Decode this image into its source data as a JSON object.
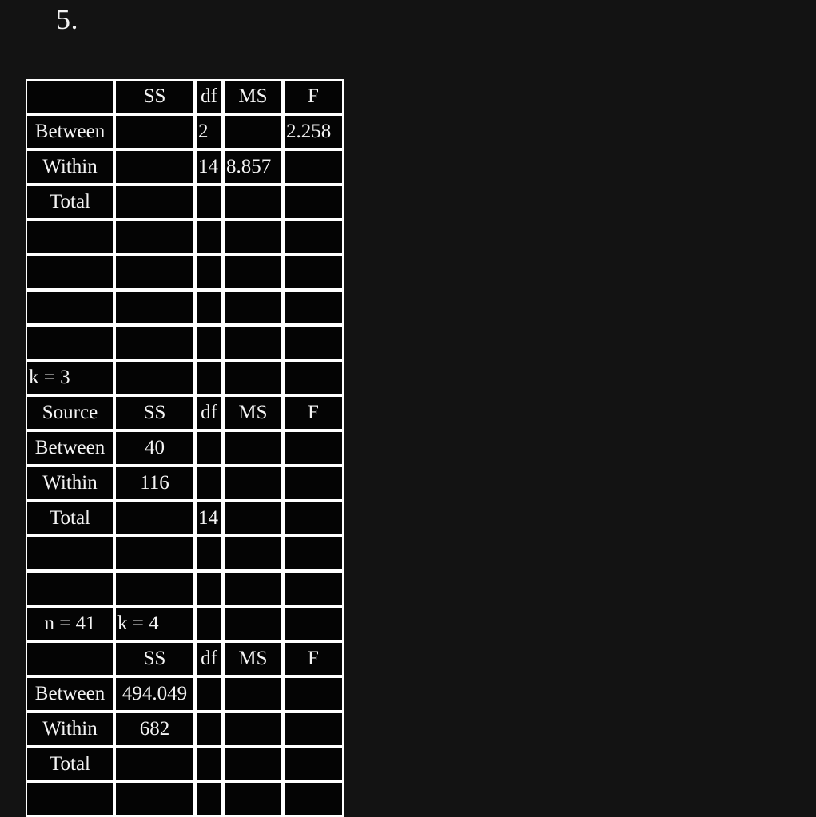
{
  "page": {
    "background_color": "#131313",
    "text_color": "#f4f4f4",
    "grid_color": "#ffffff",
    "cell_color": "#040404"
  },
  "question_number": "5.",
  "table": {
    "columns": [
      "Source",
      "SS",
      "df",
      "MS",
      "F"
    ],
    "rows": [
      {
        "cells": [
          "",
          "SS",
          "df",
          "MS",
          "F"
        ],
        "align": [
          "center",
          "center",
          "center",
          "center",
          "center"
        ]
      },
      {
        "cells": [
          "Between",
          "",
          "2",
          "",
          "2.258"
        ],
        "align": [
          "center",
          "center",
          "left",
          "center",
          "left"
        ]
      },
      {
        "cells": [
          "Within",
          "",
          "14",
          "8.857",
          ""
        ],
        "align": [
          "center",
          "center",
          "left",
          "left",
          "center"
        ]
      },
      {
        "cells": [
          "Total",
          "",
          "",
          "",
          ""
        ],
        "align": [
          "center",
          "center",
          "center",
          "center",
          "center"
        ]
      },
      {
        "cells": [
          "",
          "",
          "",
          "",
          ""
        ],
        "align": [
          "center",
          "center",
          "center",
          "center",
          "center"
        ]
      },
      {
        "cells": [
          "",
          "",
          "",
          "",
          ""
        ],
        "align": [
          "center",
          "center",
          "center",
          "center",
          "center"
        ]
      },
      {
        "cells": [
          "",
          "",
          "",
          "",
          ""
        ],
        "align": [
          "center",
          "center",
          "center",
          "center",
          "center"
        ]
      },
      {
        "cells": [
          "",
          "",
          "",
          "",
          ""
        ],
        "align": [
          "center",
          "center",
          "center",
          "center",
          "center"
        ]
      },
      {
        "cells": [
          "k = 3",
          "",
          "",
          "",
          ""
        ],
        "align": [
          "left",
          "center",
          "center",
          "center",
          "center"
        ]
      },
      {
        "cells": [
          "Source",
          "SS",
          "df",
          "MS",
          "F"
        ],
        "align": [
          "center",
          "center",
          "center",
          "center",
          "center"
        ]
      },
      {
        "cells": [
          "Between",
          "40",
          "",
          "",
          ""
        ],
        "align": [
          "center",
          "center",
          "center",
          "center",
          "center"
        ]
      },
      {
        "cells": [
          "Within",
          "116",
          "",
          "",
          ""
        ],
        "align": [
          "center",
          "center",
          "center",
          "center",
          "center"
        ]
      },
      {
        "cells": [
          "Total",
          "",
          "14",
          "",
          ""
        ],
        "align": [
          "center",
          "center",
          "left",
          "center",
          "center"
        ]
      },
      {
        "cells": [
          "",
          "",
          "",
          "",
          ""
        ],
        "align": [
          "center",
          "center",
          "center",
          "center",
          "center"
        ]
      },
      {
        "cells": [
          "",
          "",
          "",
          "",
          ""
        ],
        "align": [
          "center",
          "center",
          "center",
          "center",
          "center"
        ]
      },
      {
        "cells": [
          "n = 41",
          "k = 4",
          "",
          "",
          ""
        ],
        "align": [
          "center",
          "left",
          "center",
          "center",
          "center"
        ]
      },
      {
        "cells": [
          "",
          "SS",
          "df",
          "MS",
          "F"
        ],
        "align": [
          "center",
          "center",
          "center",
          "center",
          "center"
        ]
      },
      {
        "cells": [
          "Between",
          "494.049",
          "",
          "",
          ""
        ],
        "align": [
          "center",
          "center",
          "center",
          "center",
          "center"
        ]
      },
      {
        "cells": [
          "Within",
          "682",
          "",
          "",
          ""
        ],
        "align": [
          "center",
          "center",
          "center",
          "center",
          "center"
        ]
      },
      {
        "cells": [
          "Total",
          "",
          "",
          "",
          ""
        ],
        "align": [
          "center",
          "center",
          "center",
          "center",
          "center"
        ]
      },
      {
        "cells": [
          "",
          "",
          "",
          "",
          ""
        ],
        "align": [
          "center",
          "center",
          "center",
          "center",
          "center"
        ]
      }
    ]
  }
}
